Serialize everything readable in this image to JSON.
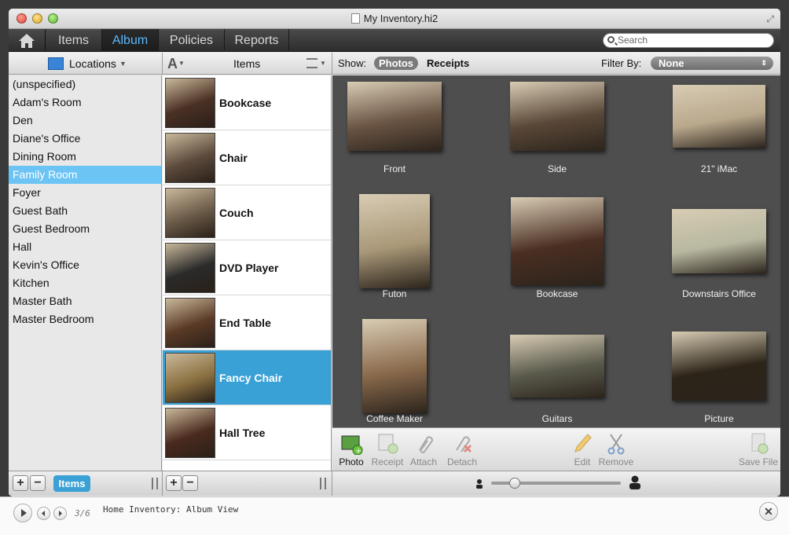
{
  "window": {
    "title": "My Inventory.hi2"
  },
  "toolbar": {
    "tabs": [
      {
        "label": "Items"
      },
      {
        "label": "Album"
      },
      {
        "label": "Policies"
      },
      {
        "label": "Reports"
      }
    ],
    "active_tab": "Album",
    "search_placeholder": "Search"
  },
  "locations": {
    "header": "Locations",
    "items": [
      "(unspecified)",
      "Adam's Room",
      "Den",
      "Diane's Office",
      "Dining Room",
      "Family Room",
      "Foyer",
      "Guest Bath",
      "Guest Bedroom",
      "Hall",
      "Kevin's Office",
      "Kitchen",
      "Master Bath",
      "Master Bedroom"
    ],
    "selected": "Family Room"
  },
  "items": {
    "sort_icon": "A",
    "header": "Items",
    "list": [
      {
        "label": "Bookcase",
        "thumb_color": "#4a3024"
      },
      {
        "label": "Chair",
        "thumb_color": "#5c4a3c"
      },
      {
        "label": "Couch",
        "thumb_color": "#6a5a48"
      },
      {
        "label": "DVD Player",
        "thumb_color": "#2a2a2a"
      },
      {
        "label": "End Table",
        "thumb_color": "#5a3a26"
      },
      {
        "label": "Fancy Chair",
        "thumb_color": "#8a7040"
      },
      {
        "label": "Hall Tree",
        "thumb_color": "#4a2a1e"
      }
    ],
    "selected": "Fancy Chair"
  },
  "show": {
    "label": "Show:",
    "options": [
      "Photos",
      "Receipts"
    ],
    "selected": "Photos",
    "filter_label": "Filter By:",
    "filter_value": "None"
  },
  "photos": [
    {
      "caption": "Front",
      "color": "#6b5544"
    },
    {
      "caption": "Side",
      "color": "#5a4838"
    },
    {
      "caption": "21\" iMac",
      "color": "#b9a88c"
    },
    {
      "caption": "Futon",
      "color": "#a99878"
    },
    {
      "caption": "Bookcase",
      "color": "#4a2e22"
    },
    {
      "caption": "Downstairs Office",
      "color": "#b8b8a0"
    },
    {
      "caption": "Coffee Maker",
      "color": "#8a6a4c"
    },
    {
      "caption": "Guitars",
      "color": "#5a5a4c"
    },
    {
      "caption": "Picture",
      "color": "#2c2418"
    }
  ],
  "actions": [
    {
      "label": "Photo",
      "enabled": true
    },
    {
      "label": "Receipt",
      "enabled": false
    },
    {
      "label": "Attach",
      "enabled": false
    },
    {
      "label": "Detach",
      "enabled": false
    },
    {
      "label": "Edit",
      "enabled": false
    },
    {
      "label": "Remove",
      "enabled": false
    },
    {
      "label": "Save File",
      "enabled": false
    }
  ],
  "bottom": {
    "items_button": "Items",
    "zoom_level": 0.18
  },
  "tutorial": {
    "counter": "3/6",
    "text": "Home Inventory: Album View"
  },
  "colors": {
    "accent": "#3aa1d6",
    "selection": "#6cc4f4",
    "tab_active": "#5ab8ff"
  }
}
